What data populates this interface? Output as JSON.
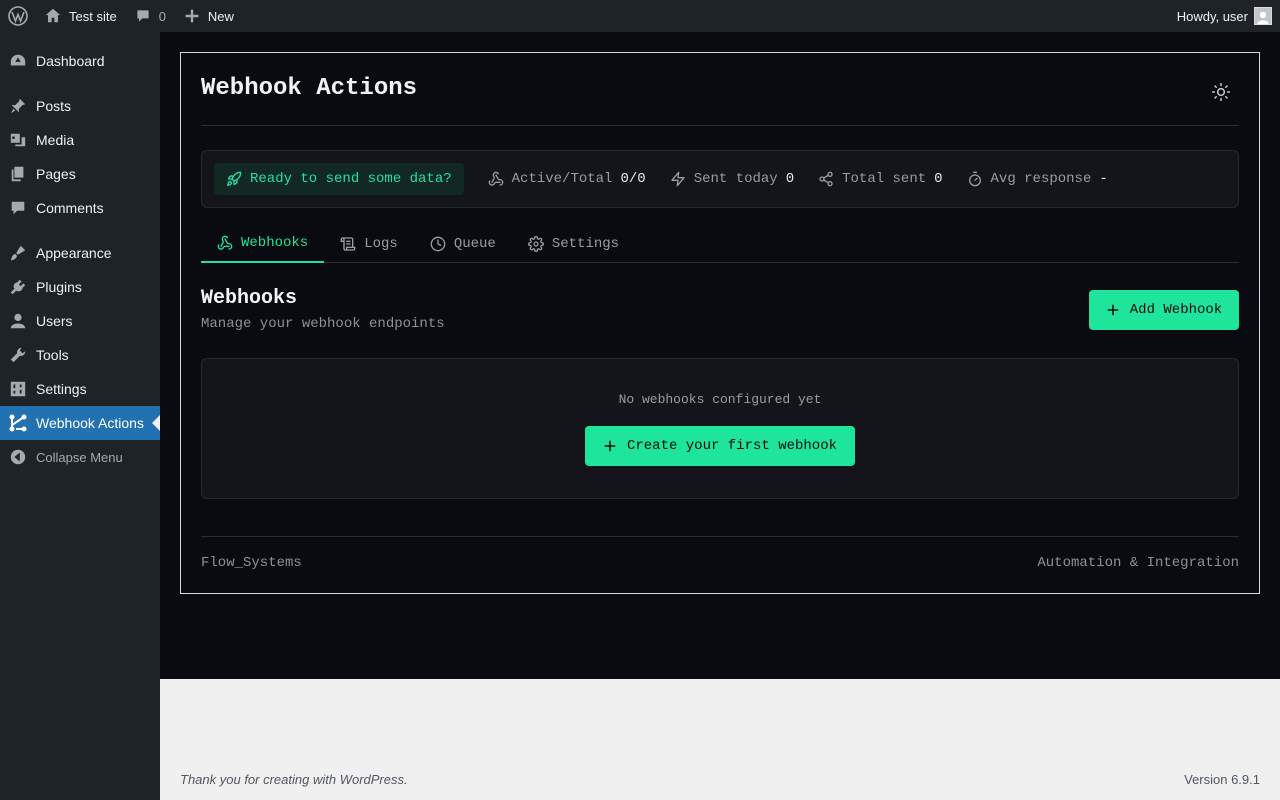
{
  "adminbar": {
    "site_name": "Test site",
    "comments_count": "0",
    "new_label": "New",
    "greeting": "Howdy, user"
  },
  "sidebar": {
    "items": [
      {
        "label": "Dashboard",
        "icon": "dashboard-icon"
      },
      {
        "label": "Posts",
        "icon": "pin-icon"
      },
      {
        "label": "Media",
        "icon": "media-icon"
      },
      {
        "label": "Pages",
        "icon": "pages-icon"
      },
      {
        "label": "Comments",
        "icon": "comment-icon"
      },
      {
        "label": "Appearance",
        "icon": "brush-icon"
      },
      {
        "label": "Plugins",
        "icon": "plug-icon"
      },
      {
        "label": "Users",
        "icon": "user-icon"
      },
      {
        "label": "Tools",
        "icon": "wrench-icon"
      },
      {
        "label": "Settings",
        "icon": "sliders-icon"
      },
      {
        "label": "Webhook Actions",
        "icon": "webhook-icon",
        "current": true
      }
    ],
    "collapse_label": "Collapse Menu"
  },
  "plugin": {
    "title": "Webhook Actions",
    "stats": {
      "ready_text": "Ready to send some data?",
      "active_total_label": "Active/Total",
      "active_total_value": "0/0",
      "sent_today_label": "Sent today",
      "sent_today_value": "0",
      "total_sent_label": "Total sent",
      "total_sent_value": "0",
      "avg_response_label": "Avg response",
      "avg_response_value": "-"
    },
    "tabs": [
      {
        "label": "Webhooks",
        "icon": "webhook-icon",
        "active": true
      },
      {
        "label": "Logs",
        "icon": "scroll-icon"
      },
      {
        "label": "Queue",
        "icon": "clock-icon"
      },
      {
        "label": "Settings",
        "icon": "gear-icon"
      }
    ],
    "section": {
      "title": "Webhooks",
      "subtitle": "Manage your webhook endpoints",
      "add_button": "Add Webhook"
    },
    "empty": {
      "message": "No webhooks configured yet",
      "create_button": "Create your first webhook"
    },
    "footer": {
      "left": "Flow_Systems",
      "right": "Automation & Integration"
    }
  },
  "wpfooter": {
    "thanks": "Thank you for creating with WordPress.",
    "version": "Version 6.9.1"
  },
  "colors": {
    "accent": "#1ee59b",
    "admin_dark": "#1d2327",
    "admin_blue": "#2271b1",
    "panel_bg": "#0a0b10"
  }
}
